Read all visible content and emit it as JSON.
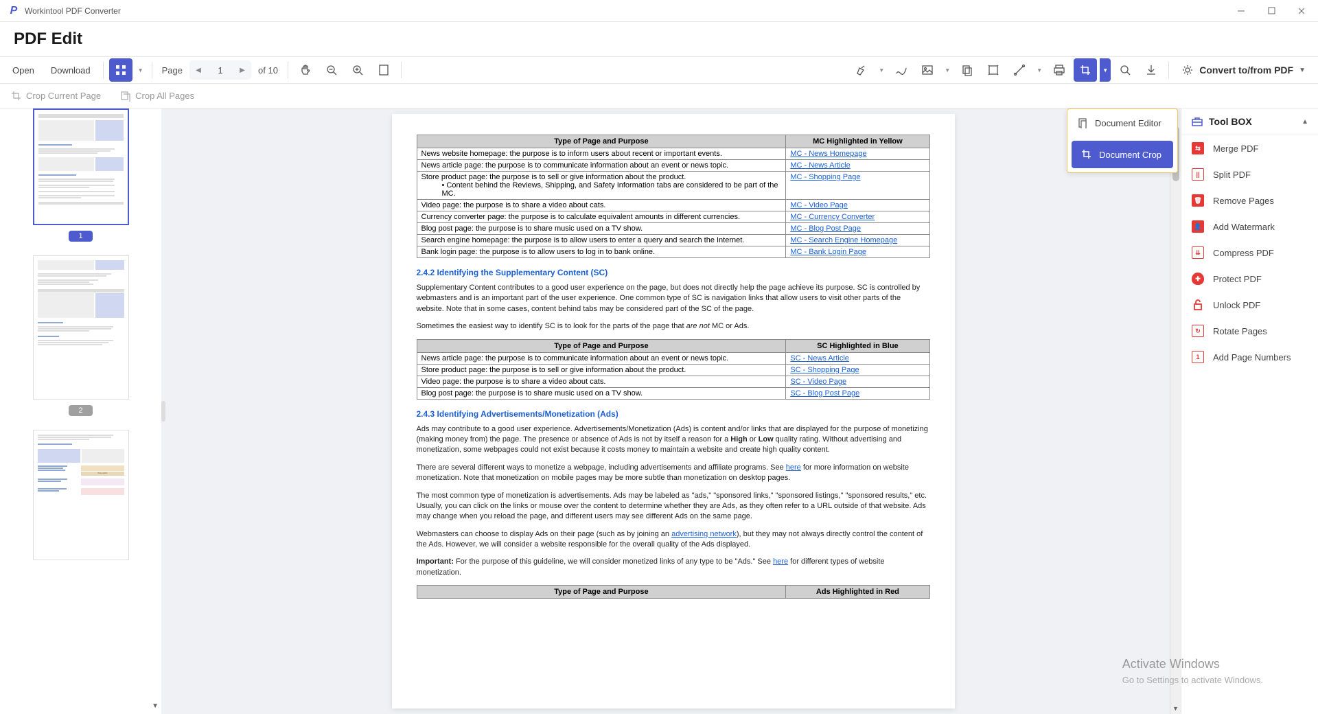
{
  "app": {
    "title": "Workintool PDF Converter",
    "page_title": "PDF Edit"
  },
  "toolbar": {
    "open": "Open",
    "download": "Download",
    "page_label": "Page",
    "page_current": "1",
    "page_total": "of 10",
    "convert_label": "Convert to/from PDF"
  },
  "subtoolbar": {
    "crop_current": "Crop Current Page",
    "crop_all": "Crop All Pages"
  },
  "popup": {
    "editor": "Document Editor",
    "crop": "Document Crop"
  },
  "toolbox": {
    "title": "Tool BOX",
    "items": [
      "Merge PDF",
      "Split PDF",
      "Remove Pages",
      "Add Watermark",
      "Compress PDF",
      "Protect PDF",
      "Unlock PDF",
      "Rotate Pages",
      "Add Page Numbers"
    ]
  },
  "thumbs": {
    "p1": "1",
    "p2": "2"
  },
  "doc": {
    "t1_h1": "Type of Page and Purpose",
    "t1_h2": "MC Highlighted in Yellow",
    "t1_r1c1": "News website homepage: the purpose is to inform users about recent or important events.",
    "t1_r1c2": "MC - News Homepage",
    "t1_r2c1": "News article page: the purpose is to communicate information about an event or news topic.",
    "t1_r2c2": "MC - News Article",
    "t1_r3c1a": "Store product page: the purpose is to sell or give information about the product.",
    "t1_r3c1b": "Content behind the Reviews, Shipping, and Safety Information tabs are considered to be part of the MC.",
    "t1_r3c2": "MC - Shopping Page",
    "t1_r4c1": "Video page: the purpose is to share a video about cats.",
    "t1_r4c2": "MC - Video Page",
    "t1_r5c1": "Currency converter page: the purpose is to calculate equivalent amounts in different currencies.",
    "t1_r5c2": "MC - Currency Converter",
    "t1_r6c1": "Blog post page: the purpose is to share music used on a TV show.",
    "t1_r6c2": "MC - Blog Post Page",
    "t1_r7c1": "Search engine homepage: the purpose is to allow users to enter a query and search the Internet.",
    "t1_r7c2": "MC - Search Engine Homepage",
    "t1_r8c1": "Bank login page: the purpose is to allow users to log in to bank online.",
    "t1_r8c2": "MC - Bank Login Page",
    "h242": "2.4.2 Identifying the Supplementary Content (SC)",
    "p242a": "Supplementary Content contributes to a good user experience on the page, but does not directly help the page achieve its purpose.  SC is controlled by webmasters and is an important part of the user experience.  One common type of SC is navigation links that allow users to visit other parts of the website.  Note that in some cases, content behind tabs may be considered part of the SC of the page.",
    "p242b_pre": "Sometimes the easiest way to identify SC is to look for the parts of the page that ",
    "p242b_i": "are not ",
    "p242b_post": "MC or Ads.",
    "t2_h1": "Type of Page and Purpose",
    "t2_h2": "SC Highlighted in Blue",
    "t2_r1c1": "News article page: the purpose is to communicate information about an event or news topic.",
    "t2_r1c2": "SC - News Article",
    "t2_r2c1": "Store product page: the purpose is to sell or give information about the product.",
    "t2_r2c2": "SC - Shopping Page",
    "t2_r3c1": "Video page: the purpose is to share a video about cats.",
    "t2_r3c2": "SC - Video Page",
    "t2_r4c1": "Blog post page: the purpose is to share music used on a TV show.",
    "t2_r4c2": "SC - Blog Post Page",
    "h243": "2.4.3 Identifying Advertisements/Monetization (Ads)",
    "p243a_pre": "Ads may contribute to a good user experience.  Advertisements/Monetization (Ads) is content and/or links that are displayed for the purpose of monetizing (making money from) the page.  The presence or absence of Ads is not by itself a reason for a ",
    "p243a_b1": "High",
    "p243a_mid1": " or ",
    "p243a_b2": "Low",
    "p243a_post": " quality rating.  Without advertising and monetization, some webpages could not exist because it costs money to maintain a website and create high quality content.",
    "p243b_pre": "There are several different ways to monetize a webpage, including advertisements and affiliate programs.  See ",
    "p243b_link": "here",
    "p243b_post": " for more information on website monetization.  Note that monetization on mobile pages may be more subtle than monetization on desktop pages.",
    "p243c": "The most common type of monetization is advertisements.  Ads may be labeled as \"ads,\" \"sponsored links,\" \"sponsored listings,\" \"sponsored results,\" etc.  Usually, you can click on the links or mouse over the content to determine whether they are Ads, as they often refer to a URL outside of that website.  Ads may change when you reload the page, and different users may see different Ads on the same page.",
    "p243d_pre": "Webmasters can choose to display Ads on their page (such as by joining an ",
    "p243d_link": "advertising network",
    "p243d_post": "), but they may not always directly control the content of the Ads.  However, we will consider a website responsible for the overall quality of the Ads displayed.",
    "p243e_b": "Important:",
    "p243e_pre": " For the purpose of this guideline, we will consider monetized links of any type to be \"Ads.\"  See ",
    "p243e_link": "here",
    "p243e_post": " for different types of website monetization.",
    "t3_h1": "Type of Page and Purpose",
    "t3_h2": "Ads Highlighted in Red"
  },
  "watermark": {
    "title": "Activate Windows",
    "sub": "Go to Settings to activate Windows."
  }
}
